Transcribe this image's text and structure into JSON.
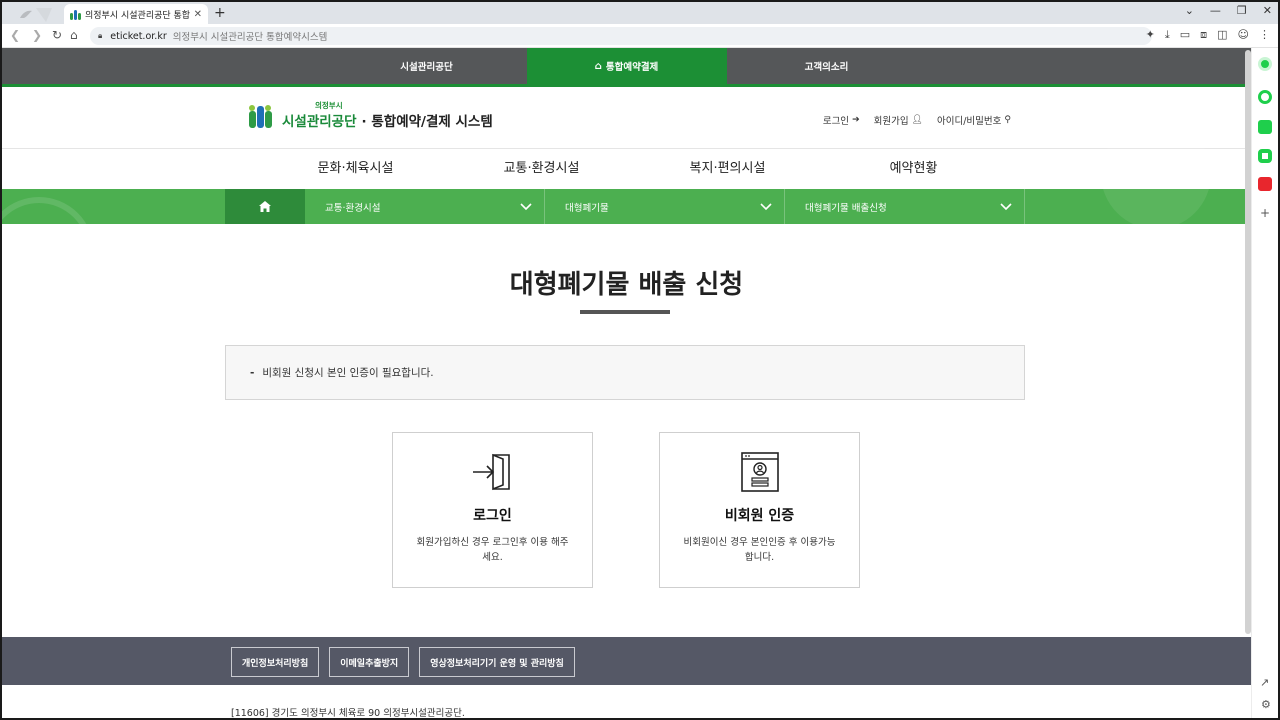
{
  "browser": {
    "tab_title": "의정부시 시설관리공단 통합예약",
    "tab_close": "✕",
    "new_tab": "+",
    "url_domain": "eticket.or.kr",
    "url_title": "의정부시 시설관리공단 통합예약시스템"
  },
  "topnav": [
    {
      "label": "시설관리공단",
      "active": false
    },
    {
      "label": "통합예약결제",
      "active": true,
      "icon": "home-icon"
    },
    {
      "label": "고객의소리",
      "active": false
    }
  ],
  "logo": {
    "small": "의정부시",
    "name": "시설관리공단",
    "system": "· 통합예약/결제 시스템"
  },
  "util": {
    "login": "로그인",
    "join": "회원가입",
    "find": "아이디/비밀번호"
  },
  "mainmenu": [
    "문화·체육시설",
    "교통·환경시설",
    "복지·편의시설",
    "예약현황"
  ],
  "subnav": {
    "level1": "교통·환경시설",
    "level2": "대형폐기물",
    "level3": "대형폐기물 배출신청"
  },
  "page": {
    "title": "대형폐기물 배출 신청",
    "notice_dash": "-",
    "notice": "비회원 신청시 본인 인증이 필요합니다."
  },
  "cards": {
    "login_title": "로그인",
    "login_desc": "회원가입하신 경우 로그인후 이용 해주세요.",
    "guest_title": "비회원 인증",
    "guest_desc": "비회원이신 경우 본인인증 후 이용가능합니다."
  },
  "footer": {
    "links": [
      "개인정보처리방침",
      "이메일추출방지",
      "영상정보처리기기 운영 및 관리방침"
    ],
    "address": "[11606] 경기도 의정부시 체육로 90 의정부시설관리공단."
  },
  "colors": {
    "brand_green": "#1c8f35",
    "subnav_green": "#4caf50",
    "topnav_gray": "#555759",
    "footer_gray": "#555866"
  }
}
